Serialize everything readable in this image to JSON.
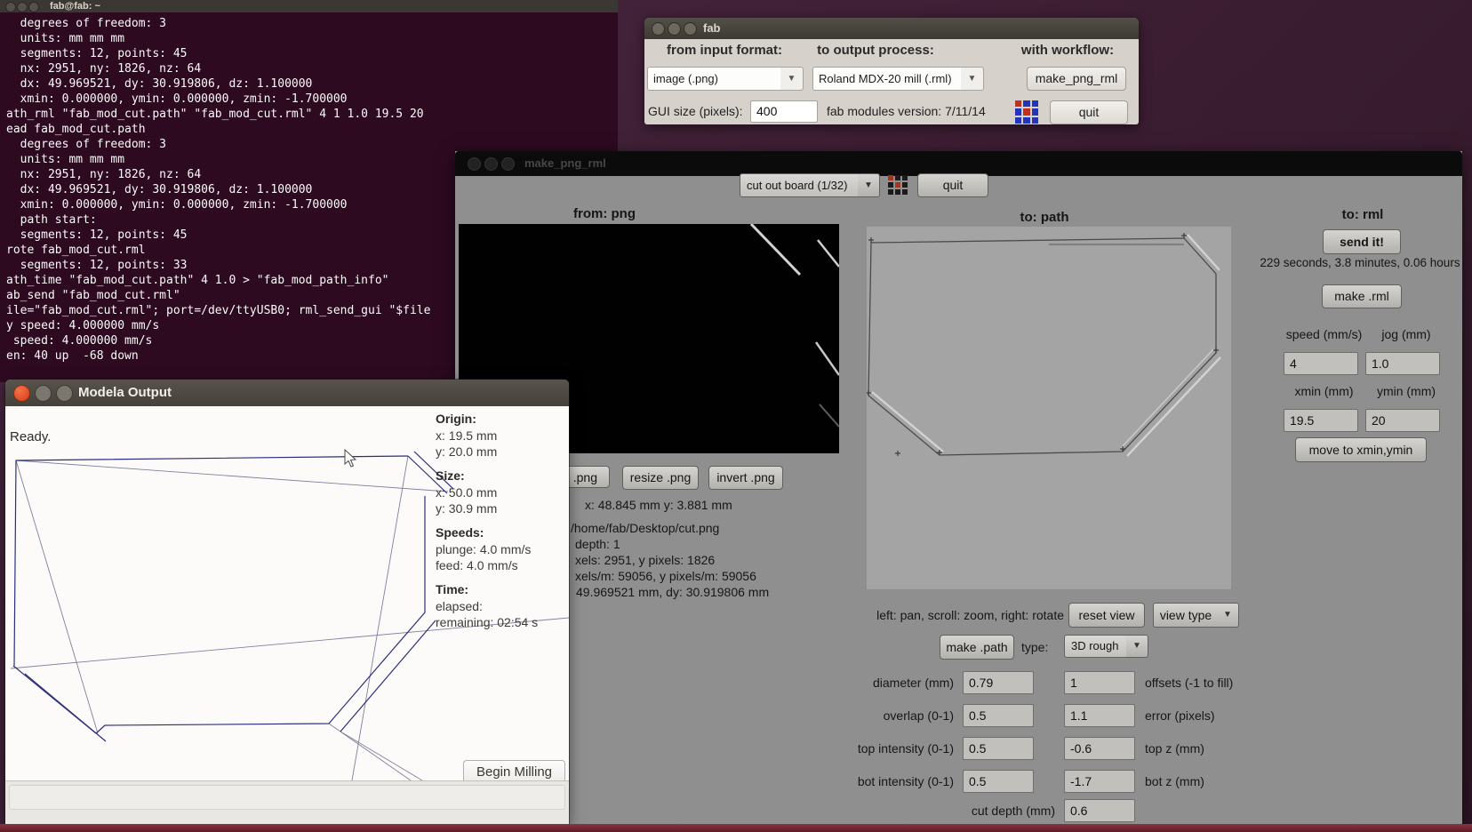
{
  "colors": {
    "desktop": "#3b1d31",
    "terminal_bg": "#2e0a21",
    "ubuntu_orange": "#e95420",
    "logo_red": "#c03121",
    "logo_blue": "#2335bb",
    "window_gray": "#8f8f8f",
    "strip_red": "#7d2434"
  },
  "terminal": {
    "title": "fab@fab: ~",
    "lines": [
      "  degrees of freedom: 3",
      "  units: mm mm mm",
      "  segments: 12, points: 45",
      "  nx: 2951, ny: 1826, nz: 64",
      "  dx: 49.969521, dy: 30.919806, dz: 1.100000",
      "  xmin: 0.000000, ymin: 0.000000, zmin: -1.700000",
      "ath_rml \"fab_mod_cut.path\" \"fab_mod_cut.rml\" 4 1 1.0 19.5 20",
      "ead fab_mod_cut.path",
      "  degrees of freedom: 3",
      "  units: mm mm mm",
      "  nx: 2951, ny: 1826, nz: 64",
      "  dx: 49.969521, dy: 30.919806, dz: 1.100000",
      "  xmin: 0.000000, ymin: 0.000000, zmin: -1.700000",
      "  path start:",
      "  segments: 12, points: 45",
      "rote fab_mod_cut.rml",
      "  segments: 12, points: 33",
      "ath_time \"fab_mod_cut.path\" 4 1.0 > \"fab_mod_path_info\"",
      "ab_send \"fab_mod_cut.rml\"",
      "ile=\"fab_mod_cut.rml\"; port=/dev/ttyUSB0; rml_send_gui \"$file",
      "y speed: 4.000000 mm/s",
      " speed: 4.000000 mm/s",
      "en: 40 up  -68 down"
    ]
  },
  "fab_window": {
    "title": "fab",
    "col1_label": "from input format:",
    "col2_label": "to output process:",
    "col3_label": "with workflow:",
    "input_format_value": "image (.png)",
    "output_process_value": "Roland MDX-20 mill (.rml)",
    "workflow_button": "make_png_rml",
    "gui_size_label": "GUI size (pixels):",
    "gui_size_value": "400",
    "version_text": "fab modules version: 7/11/14",
    "quit_button": "quit"
  },
  "make_png_rml": {
    "title": "make_png_rml",
    "preset_value": "cut out board (1/32)",
    "quit_button": "quit",
    "from_png": {
      "header": "from: png",
      "load_button": ".png",
      "resize_button": "resize .png",
      "invert_button": "invert .png",
      "cursor_pos": "x: 48.845 mm  y: 3.881 mm",
      "file_path": "/home/fab/Desktop/cut.png",
      "info_line1": "depth: 1",
      "info_line2": "xels: 2951, y pixels: 1826",
      "info_line3": "xels/m: 59056, y pixels/m: 59056",
      "info_line4": "49.969521 mm, dy: 30.919806 mm"
    },
    "to_path": {
      "header": "to: path",
      "hint": "left: pan, scroll: zoom, right: rotate",
      "reset_view_button": "reset view",
      "view_type_button": "view type",
      "make_path_button": "make .path",
      "type_label": "type:",
      "type_value": "3D rough",
      "rows": [
        {
          "label": "diameter (mm)",
          "value1": "0.79",
          "value2": "1",
          "label2": "offsets (-1 to fill)"
        },
        {
          "label": "overlap (0-1)",
          "value1": "0.5",
          "value2": "1.1",
          "label2": "error (pixels)"
        },
        {
          "label": "top intensity (0-1)",
          "value1": "0.5",
          "value2": "-0.6",
          "label2": "top z (mm)"
        },
        {
          "label": "bot intensity (0-1)",
          "value1": "0.5",
          "value2": "-1.7",
          "label2": "bot z (mm)"
        }
      ],
      "cut_depth_label": "cut depth (mm)",
      "cut_depth_value": "0.6"
    },
    "to_rml": {
      "header": "to: rml",
      "send_button": "send it!",
      "time_text": "229 seconds, 3.8 minutes, 0.06 hours",
      "make_rml_button": "make .rml",
      "speed_label": "speed (mm/s)",
      "jog_label": "jog (mm)",
      "speed_value": "4",
      "jog_value": "1.0",
      "xmin_label": "xmin (mm)",
      "ymin_label": "ymin (mm)",
      "xmin_value": "19.5",
      "ymin_value": "20",
      "move_button": "move to xmin,ymin"
    }
  },
  "modela": {
    "title": "Modela Output",
    "origin_header": "Origin:",
    "origin_x": "x: 19.5 mm",
    "origin_y": "y: 20.0 mm",
    "size_header": "Size:",
    "size_x": "x: 50.0 mm",
    "size_y": "y: 30.9 mm",
    "speeds_header": "Speeds:",
    "plunge": "plunge: 4.0 mm/s",
    "feed": "feed: 4.0 mm/s",
    "time_header": "Time:",
    "elapsed": "elapsed:",
    "remaining": "remaining: 02:54 s",
    "begin_button": "Begin Milling",
    "status": "Ready."
  }
}
